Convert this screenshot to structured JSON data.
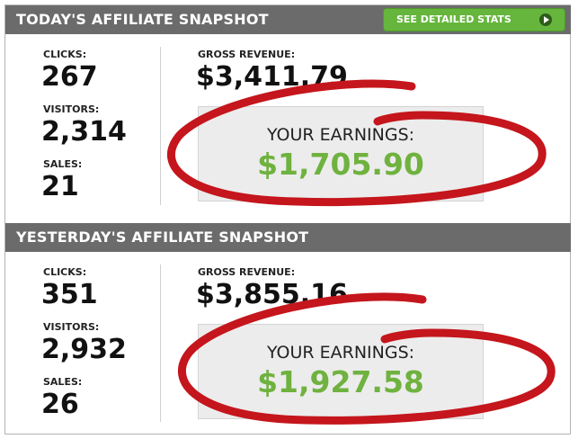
{
  "today": {
    "title": "TODAY'S AFFILIATE SNAPSHOT",
    "button_label": "SEE DETAILED STATS",
    "clicks_label": "CLICKS:",
    "clicks_value": "267",
    "visitors_label": "VISITORS:",
    "visitors_value": "2,314",
    "sales_label": "SALES:",
    "sales_value": "21",
    "gross_label": "GROSS REVENUE:",
    "gross_value": "$3,411.79",
    "earnings_label": "YOUR EARNINGS:",
    "earnings_value": "$1,705.90"
  },
  "yesterday": {
    "title": "YESTERDAY'S AFFILIATE SNAPSHOT",
    "clicks_label": "CLICKS:",
    "clicks_value": "351",
    "visitors_label": "VISITORS:",
    "visitors_value": "2,932",
    "sales_label": "SALES:",
    "sales_value": "26",
    "gross_label": "GROSS REVENUE:",
    "gross_value": "$3,855.16",
    "earnings_label": "YOUR EARNINGS:",
    "earnings_value": "$1,927.58"
  },
  "icons": {
    "button_icon": "play-icon",
    "annotation": "red-circle-annotation"
  },
  "colors": {
    "header": "#6b6b6b",
    "button": "#66b53d",
    "earnings": "#6fb23f",
    "circle": "#c4161c"
  }
}
